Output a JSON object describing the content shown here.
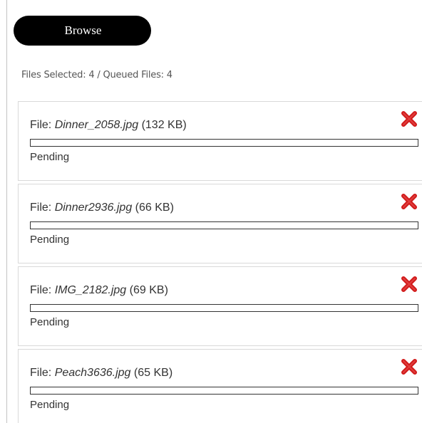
{
  "toolbar": {
    "browse_label": "Browse"
  },
  "summary": {
    "status_text": "Files Selected: 4 / Queued Files: 4"
  },
  "queue": {
    "file_prefix": "File:",
    "items": [
      {
        "name": "Dinner_2058.jpg",
        "size": "(132 KB)",
        "status": "Pending",
        "progress": 0
      },
      {
        "name": "Dinner2936.jpg",
        "size": "(66 KB)",
        "status": "Pending",
        "progress": 0
      },
      {
        "name": "IMG_2182.jpg",
        "size": "(69 KB)",
        "status": "Pending",
        "progress": 0
      },
      {
        "name": "Peach3636.jpg",
        "size": "(65 KB)",
        "status": "Pending",
        "progress": 0
      }
    ]
  },
  "icons": {
    "cancel": "cancel-x-icon"
  },
  "colors": {
    "cancel_red": "#d11a1a",
    "button_bg": "#000000"
  }
}
